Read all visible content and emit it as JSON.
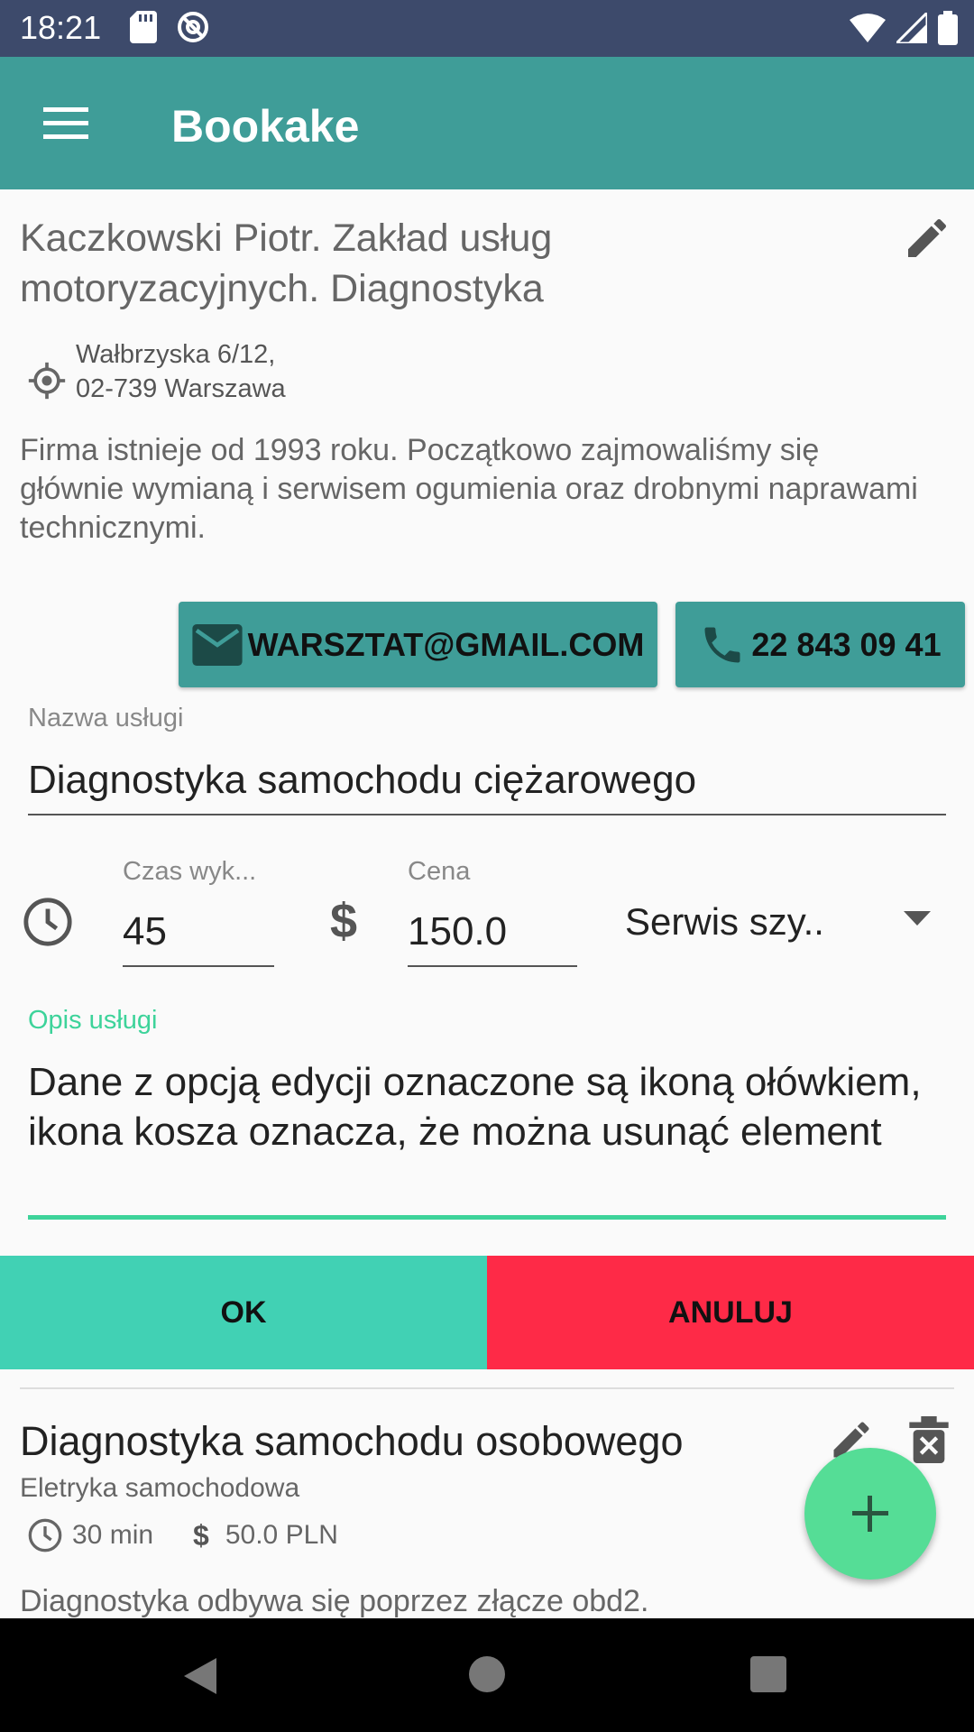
{
  "status_bar": {
    "time": "18:21",
    "left_icons": [
      "sd-card-icon",
      "vpn-icon"
    ],
    "right_icons": [
      "wifi-icon",
      "signal-icon",
      "battery-icon"
    ]
  },
  "app_bar": {
    "title": "Bookake",
    "menu_icon": "menu-icon",
    "color": "#3f9d98"
  },
  "business": {
    "name": "Kaczkowski Piotr. Zakład usług motoryzacyjnych. Diagnostyka",
    "address_line1": "Wałbrzyska 6/12,",
    "address_line2": "02-739 Warszawa",
    "description": "Firma istnieje od 1993 roku. Początkowo zajmowaliśmy się głównie wymianą i serwisem ogumienia oraz drobnymi naprawami technicznymi.",
    "email": "WARSZTAT@GMAIL.COM",
    "phone": "22 843 09 41"
  },
  "form": {
    "name_label": "Nazwa usługi",
    "name_value": "Diagnostyka samochodu ciężarowego",
    "time_label": "Czas wyk...",
    "time_value": "45",
    "price_label": "Cena",
    "price_value": "150.0",
    "price_icon_glyph": "$",
    "category_value": "Serwis szy..",
    "desc_label": "Opis usługi",
    "desc_value": "Dane z opcją edycji oznaczone są ikoną ołówkiem, ikona kosza oznacza, że można usunąć element",
    "ok_label": "OK",
    "cancel_label": "ANULUJ",
    "ok_color": "#41d1b4",
    "cancel_color": "#fe2a47",
    "accent_color": "#3dd39a"
  },
  "services": [
    {
      "title": "Diagnostyka samochodu osobowego",
      "category": "Eletryka samochodowa",
      "duration": "30 min",
      "price_glyph": "$",
      "price": "50.0 PLN",
      "description": "Diagnostyka odbywa się poprzez złącze obd2."
    }
  ],
  "fab": {
    "icon": "plus-icon",
    "color": "#55dd96"
  },
  "nav_bar": {
    "icons": [
      "back-icon",
      "home-icon",
      "recents-icon"
    ]
  }
}
